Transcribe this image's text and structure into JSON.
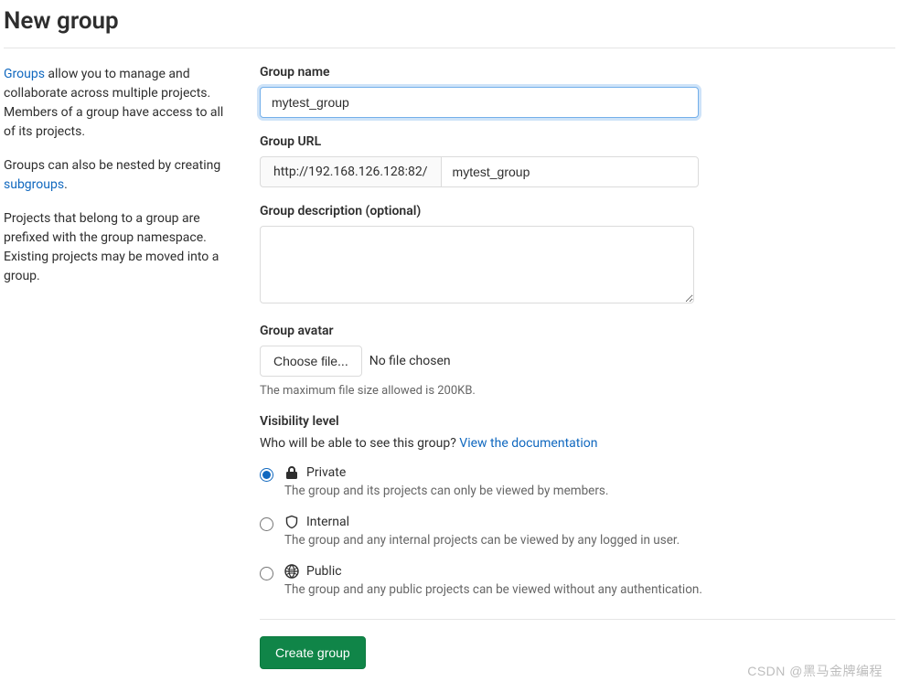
{
  "page_title": "New group",
  "sidebar": {
    "p1_link": "Groups",
    "p1_text": " allow you to manage and collaborate across multiple projects. Members of a group have access to all of its projects.",
    "p2_text": "Groups can also be nested by creating ",
    "p2_link": "subgroups",
    "p2_suffix": ".",
    "p3_text": "Projects that belong to a group are prefixed with the group namespace. Existing projects may be moved into a group."
  },
  "form": {
    "group_name_label": "Group name",
    "group_name_value": "mytest_group",
    "group_url_label": "Group URL",
    "group_url_prefix": "http://192.168.126.128:82/",
    "group_url_value": "mytest_group",
    "description_label": "Group description (optional)",
    "description_value": "",
    "avatar_label": "Group avatar",
    "choose_file_label": "Choose file...",
    "file_status": "No file chosen",
    "file_help": "The maximum file size allowed is 200KB.",
    "visibility_label": "Visibility level",
    "visibility_intro": "Who will be able to see this group? ",
    "visibility_doc_link": "View the documentation",
    "visibility": {
      "private_title": "Private",
      "private_desc": "The group and its projects can only be viewed by members.",
      "internal_title": "Internal",
      "internal_desc": "The group and any internal projects can be viewed by any logged in user.",
      "public_title": "Public",
      "public_desc": "The group and any public projects can be viewed without any authentication."
    },
    "submit_label": "Create group"
  },
  "watermark": "CSDN @黑马金牌编程"
}
